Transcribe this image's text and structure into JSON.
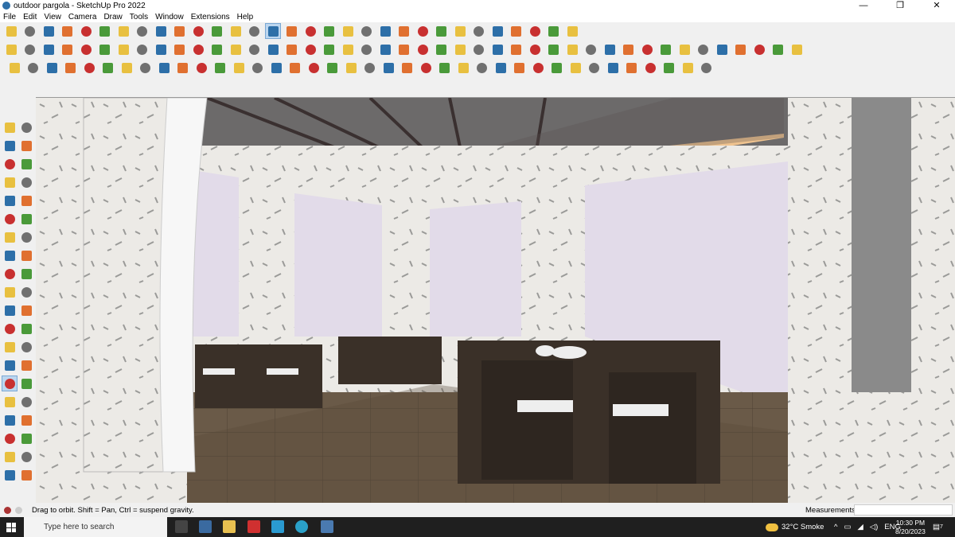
{
  "window": {
    "title": "outdoor pargola - SketchUp Pro 2022",
    "controls": [
      "—",
      "❐",
      "✕"
    ]
  },
  "menu": [
    "File",
    "Edit",
    "View",
    "Camera",
    "Draw",
    "Tools",
    "Window",
    "Extensions",
    "Help"
  ],
  "toolbars": {
    "row1": [
      "search-icon",
      "select-icon",
      "eraser-icon",
      "line-icon",
      "arc-icon",
      "paint-icon",
      "push-pull-icon",
      "follow-me-icon",
      "move-icon",
      "rotate-icon",
      "scale-icon",
      "tape-icon",
      "text-icon",
      "paint-bucket-icon",
      "orbit-icon",
      "pan-icon",
      "zoom-icon",
      "zoom-extents-icon",
      "section-icon",
      "section-cut-icon",
      "section-display-icon",
      "geo-icon",
      "component-icon",
      "warehouse-icon",
      "extension-icon",
      "arrows-icon",
      "sandbox-icon",
      "flip-icon",
      "undo-icon",
      "redo-icon",
      "export-icon"
    ],
    "row2": [
      "iso-view-icon",
      "top-view-icon",
      "front-view-icon",
      "right-view-icon",
      "back-view-icon",
      "left-view-icon",
      "bottom-view-icon",
      "xray-icon",
      "wireframe-icon",
      "hidden-line-icon",
      "shaded-icon",
      "textured-icon",
      "monochrome-icon",
      "house-icon",
      "house2-icon",
      "house3-icon",
      "house4-icon",
      "pie-icon",
      "pencil-icon",
      "shape1-icon",
      "shape2-icon",
      "shape3-icon",
      "shape4-icon",
      "shape5-icon",
      "shape6-icon",
      "shape7-icon",
      "shape8-icon",
      "shape9-icon",
      "shape10-icon",
      "shape11-icon",
      "shape12-icon",
      "shape13-icon",
      "shape14-icon",
      "shape15-icon",
      "shape16-icon",
      "shape17-icon",
      "shape18-icon",
      "shape19-icon",
      "shape20-icon",
      "shape21-icon",
      "shape22-icon",
      "shape23-icon",
      "shape24-icon"
    ],
    "row3": [
      "box-icon",
      "cube-icon",
      "cube2-icon",
      "tool1-icon",
      "tool2-icon",
      "tool3-icon",
      "tool4-icon",
      "tool5-icon",
      "tool6-icon",
      "tool7-icon",
      "tool8-icon",
      "tool9-icon",
      "tool10-icon",
      "tool11-icon",
      "tool12-icon",
      "tool13-icon",
      "tool14-icon",
      "tool15-icon",
      "tool16-icon",
      "tool17-icon",
      "tool18-icon",
      "tool19-icon",
      "tool20-icon",
      "tool21-icon",
      "tool22-icon",
      "tool23-icon",
      "tool24-icon",
      "tool25-icon",
      "tool26-icon",
      "tool27-icon",
      "tool28-icon",
      "tool29-icon",
      "tool30-icon",
      "tool31-icon",
      "tool32-icon",
      "tool33-icon",
      "tool34-icon",
      "tool35-icon"
    ],
    "left": [
      "select-icon",
      "component-icon",
      "paint-bucket-icon",
      "eraser-icon",
      "tag-icon",
      "pencil-icon",
      "line-icon",
      "freehand-icon",
      "rectangle-icon",
      "rotated-rect-icon",
      "circle-icon",
      "polygon-icon",
      "arc-icon",
      "pie-icon",
      "arc3-icon",
      "arc4-icon",
      "move-icon",
      "push-pull-icon",
      "rotate-icon",
      "follow-me-icon",
      "scale-icon",
      "offset-icon",
      "tape-icon",
      "text-icon",
      "protractor-icon",
      "axes-icon",
      "dimension-icon",
      "3d-text-icon",
      "orbit-icon",
      "pan-icon",
      "zoom-icon",
      "zoom-window-icon",
      "zoom-extents-icon",
      "previous-view-icon",
      "position-camera-icon",
      "look-around-icon",
      "walk-icon",
      "section-plane-icon",
      "section-icon",
      "section-display-icon"
    ]
  },
  "colors": {
    "accent": "#2d6fa8",
    "orange": "#e07030",
    "red": "#c83030",
    "green": "#4a9a3a",
    "yellow": "#e8c040",
    "grey": "#707070"
  },
  "status": {
    "message": "Drag to orbit. Shift = Pan, Ctrl = suspend gravity.",
    "measurements_label": "Measurements",
    "measurements_value": ""
  },
  "taskbar": {
    "search_placeholder": "Type here to search",
    "weather": "32°C  Smoke",
    "lang": "ENG",
    "time": "10:30 PM",
    "date": "8/20/2023",
    "notifications": "7"
  }
}
